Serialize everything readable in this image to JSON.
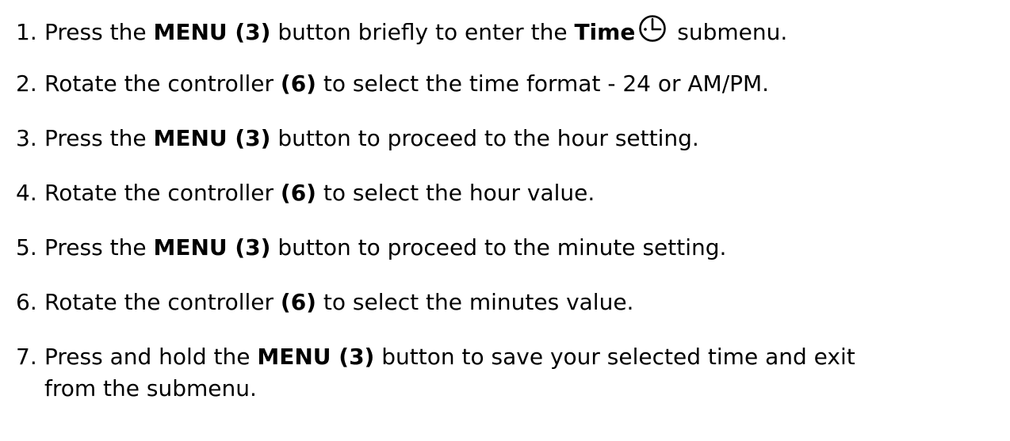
{
  "steps": [
    {
      "number": "1.",
      "pre": "Press the ",
      "bold1": "MENU (3)",
      "mid": " button briefly to enter the ",
      "bold2": "Time",
      "icon": "clock-icon",
      "post": " submenu."
    },
    {
      "number": "2.",
      "pre": "Rotate the controller ",
      "bold": "(6)",
      "post": " to select the time format - 24 or AM/PM."
    },
    {
      "number": "3.",
      "pre": "Press the ",
      "bold": "MENU (3)",
      "post": " button to proceed to the hour setting."
    },
    {
      "number": "4.",
      "pre": "Rotate the controller ",
      "bold": "(6)",
      "post": " to select the hour value."
    },
    {
      "number": "5.",
      "pre": "Press the ",
      "bold": "MENU (3)",
      "post": " button to proceed to the minute setting."
    },
    {
      "number": "6.",
      "pre": "Rotate the controller ",
      "bold": "(6)",
      "post": " to select the minutes value."
    },
    {
      "number": "7.",
      "pre": "Press and hold the ",
      "bold": "MENU (3)",
      "post": " button to save your selected time and exit",
      "continuation": "from the submenu."
    }
  ]
}
